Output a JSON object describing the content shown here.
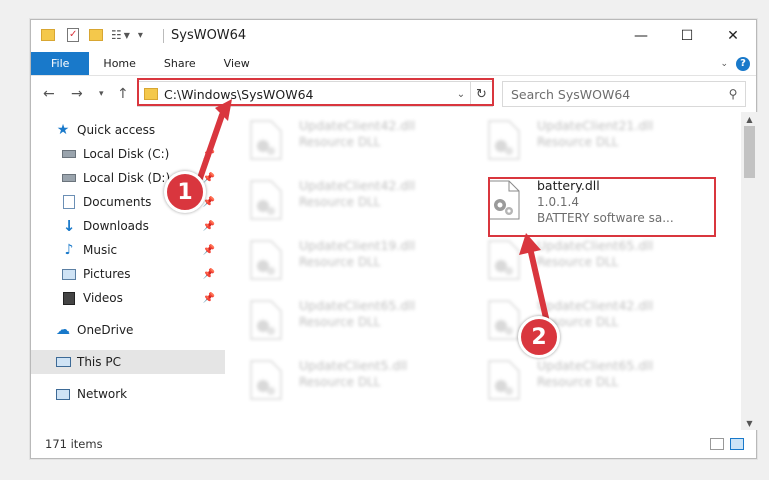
{
  "window": {
    "title": "SysWOW64",
    "controls": {
      "minimize": "—",
      "maximize": "☐",
      "close": "✕"
    }
  },
  "ribbon": {
    "tabs": [
      "File",
      "Home",
      "Share",
      "View"
    ],
    "help": "?"
  },
  "address": {
    "path": "C:\\Windows\\SysWOW64",
    "search_placeholder": "Search SysWOW64"
  },
  "nav": {
    "items": [
      {
        "label": "Quick access",
        "icon": "star-icon"
      },
      {
        "label": "Local Disk (C:)",
        "icon": "drive-icon",
        "pinned": true
      },
      {
        "label": "Local Disk (D:)",
        "icon": "drive-icon",
        "pinned": true
      },
      {
        "label": "Documents",
        "icon": "documents-icon",
        "pinned": true
      },
      {
        "label": "Downloads",
        "icon": "download-icon",
        "pinned": true
      },
      {
        "label": "Music",
        "icon": "music-icon",
        "pinned": true
      },
      {
        "label": "Pictures",
        "icon": "pictures-icon",
        "pinned": true
      },
      {
        "label": "Videos",
        "icon": "videos-icon",
        "pinned": true
      },
      {
        "label": "OneDrive",
        "icon": "cloud-icon"
      },
      {
        "label": "This PC",
        "icon": "computer-icon",
        "selected": true
      },
      {
        "label": "Network",
        "icon": "network-icon"
      }
    ]
  },
  "files": [
    {
      "name": "UpdateClient42.dll",
      "sub": "Resource DLL"
    },
    {
      "name": "UpdateClient21.dll",
      "sub": "Resource DLL"
    },
    {
      "name": "UpdateClient42.dll",
      "sub": "Resource DLL"
    },
    {
      "name": "battery.dll",
      "sub": "1.0.1.4",
      "sub2": "BATTERY software sa...",
      "highlighted": true
    },
    {
      "name": "UpdateClient19.dll",
      "sub": "Resource DLL"
    },
    {
      "name": "UpdateClient65.dll",
      "sub": "Resource DLL"
    },
    {
      "name": "UpdateClient65.dll",
      "sub": "Resource DLL"
    },
    {
      "name": "UpdateClient42.dll",
      "sub": "Resource DLL"
    },
    {
      "name": "UpdateClient5.dll",
      "sub": "Resource DLL"
    },
    {
      "name": "UpdateClient65.dll",
      "sub": "Resource DLL"
    }
  ],
  "status": {
    "count": "171 items"
  },
  "callouts": [
    "1",
    "2"
  ],
  "colors": {
    "accent": "#1979ca",
    "highlight": "#d9363e"
  }
}
